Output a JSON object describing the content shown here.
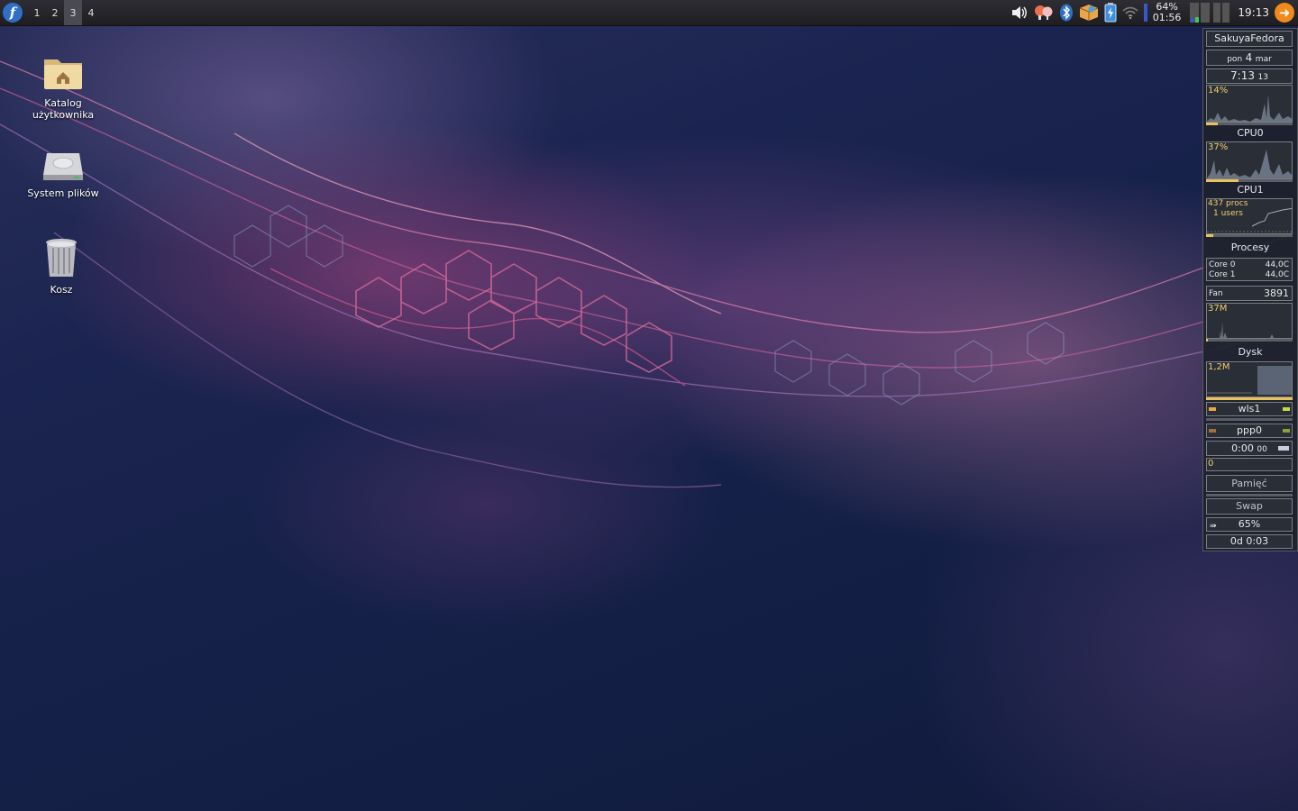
{
  "panel": {
    "workspaces": [
      "1",
      "2",
      "3",
      "4"
    ],
    "active_workspace": "3",
    "battery_percent": "64%",
    "battery_time": "01:56",
    "clock": "19:13",
    "tray_icons": [
      "volume-icon",
      "messenger-icon",
      "bluetooth-icon",
      "package-updater-icon",
      "battery-icon",
      "wifi-icon",
      "cpu-monitor-icon",
      "logout-icon"
    ]
  },
  "desktop": {
    "icons": [
      {
        "label": "Katalog użytkownika",
        "icon": "home-folder-icon"
      },
      {
        "label": "System plików",
        "icon": "hard-drive-icon"
      },
      {
        "label": "Kosz",
        "icon": "trash-icon"
      }
    ]
  },
  "conky": {
    "hostname": "SakuyaFedora",
    "day": "pon",
    "date_num": "4",
    "month": "mar",
    "time": "7:13",
    "seconds": "13",
    "cpu0_label": "CPU0",
    "cpu0_percent": "14%",
    "cpu1_label": "CPU1",
    "cpu1_percent": "37%",
    "procs": "437 procs",
    "users": "1 users",
    "processes_label": "Procesy",
    "core0_label": "Core 0",
    "core0_temp": "44,0C",
    "core1_label": "Core 1",
    "core1_temp": "44,0C",
    "fan_label": "Fan",
    "fan_value": "3891",
    "mem_value": "37M",
    "disk_label": "Dysk",
    "disk_value": "1,2M",
    "net1_label": "wls1",
    "net2_label": "ppp0",
    "conn_time": "0:00",
    "conn_seconds": "00",
    "traffic_value": "0",
    "memory_label": "Pamięć",
    "swap_label": "Swap",
    "battery_percent": "65%",
    "uptime": "0d  0:03",
    "colors": {
      "accent": "#e9c35a",
      "panel_bg": "#2a2e36",
      "border": "#7a7d84"
    }
  }
}
